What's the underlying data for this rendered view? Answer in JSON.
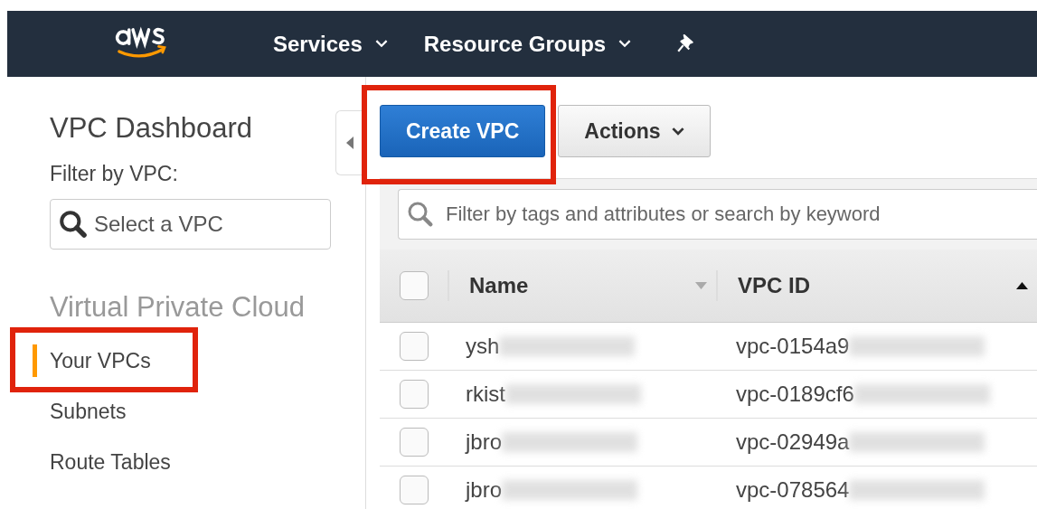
{
  "nav": {
    "items": [
      {
        "label": "Services"
      },
      {
        "label": "Resource Groups"
      }
    ]
  },
  "sidebar": {
    "title": "VPC Dashboard",
    "filter_label": "Filter by VPC:",
    "filter": {
      "placeholder": "Select a VPC"
    },
    "section": "Virtual Private Cloud",
    "items": [
      {
        "label": "Your VPCs",
        "selected": true,
        "highlighted": true
      },
      {
        "label": "Subnets",
        "selected": false,
        "highlighted": false
      },
      {
        "label": "Route Tables",
        "selected": false,
        "highlighted": false
      }
    ]
  },
  "toolbar": {
    "buttons": [
      {
        "label": "Create VPC",
        "kind": "primary",
        "highlighted": true
      },
      {
        "label": "Actions",
        "kind": "dropdown",
        "highlighted": false
      }
    ]
  },
  "search": {
    "placeholder": "Filter by tags and attributes or search by keyword"
  },
  "table": {
    "all_checked": false,
    "columns": [
      {
        "label": "Name",
        "sorted": false
      },
      {
        "label": "VPC ID",
        "sorted": true
      }
    ],
    "rows": [
      {
        "name": "ysh",
        "vpc_id": "vpc-0154a9",
        "checked": false
      },
      {
        "name": "rkist",
        "vpc_id": "vpc-0189cf6",
        "checked": false
      },
      {
        "name": "jbro",
        "vpc_id": "vpc-02949a",
        "checked": false
      },
      {
        "name": "jbro",
        "vpc_id": "vpc-078564",
        "checked": false
      }
    ]
  }
}
